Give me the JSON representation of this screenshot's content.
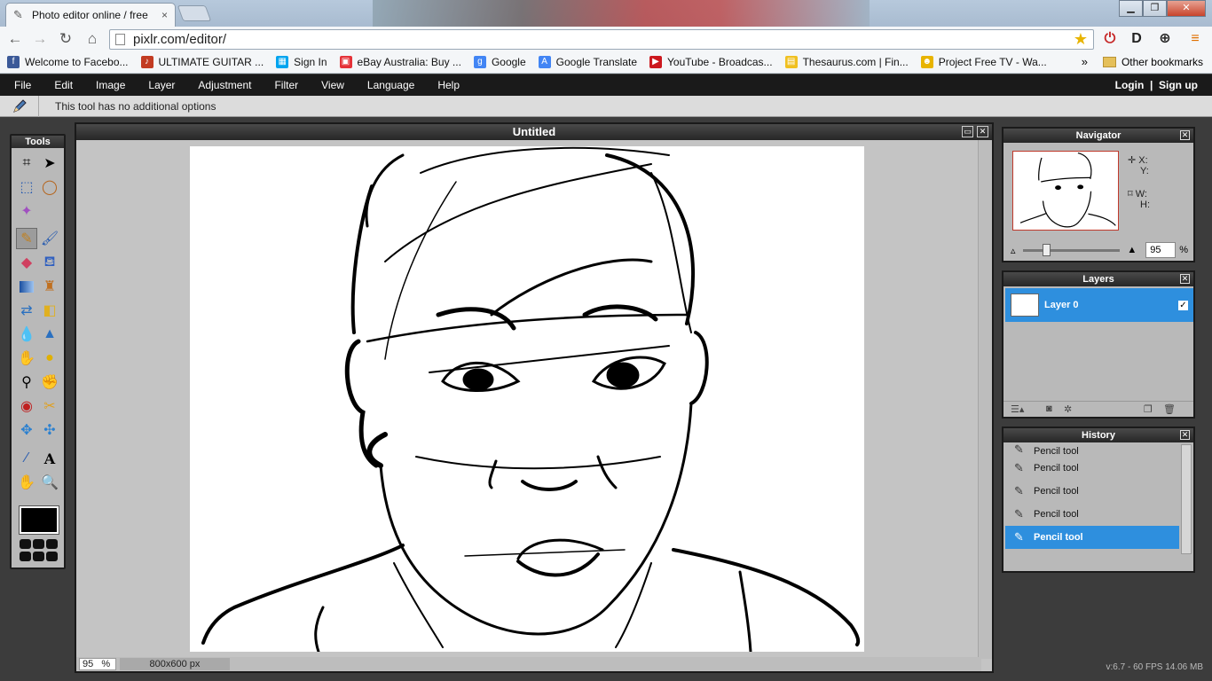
{
  "browser": {
    "tab_title": "Photo editor online / free",
    "tab_close": "×",
    "url": "pixlr.com/editor/",
    "bookmarks": [
      {
        "label": "Welcome to Facebo...",
        "color": "#3b5998",
        "glyph": "f"
      },
      {
        "label": "ULTIMATE GUITAR ...",
        "color": "#c23b22",
        "glyph": "♪"
      },
      {
        "label": "Sign In",
        "color": "#00a4ef",
        "glyph": "▦"
      },
      {
        "label": "eBay Australia: Buy ...",
        "color": "#e53238",
        "glyph": "▣"
      },
      {
        "label": "Google",
        "color": "#4285f4",
        "glyph": "g"
      },
      {
        "label": "Google Translate",
        "color": "#4285f4",
        "glyph": "A"
      },
      {
        "label": "YouTube - Broadcas...",
        "color": "#cc181e",
        "glyph": "▶"
      },
      {
        "label": "Thesaurus.com | Fin...",
        "color": "#f0c020",
        "glyph": "▤"
      },
      {
        "label": "Project Free TV - Wa...",
        "color": "#e8b400",
        "glyph": "☻"
      }
    ],
    "bookmarks_more": "»",
    "other_bookmarks": "Other bookmarks"
  },
  "menu": {
    "items": [
      "File",
      "Edit",
      "Image",
      "Layer",
      "Adjustment",
      "Filter",
      "View",
      "Language",
      "Help"
    ],
    "login": "Login",
    "separator": "|",
    "signup": "Sign up"
  },
  "options": {
    "text": "This tool has no additional options"
  },
  "tools_panel": {
    "title": "Tools"
  },
  "document": {
    "title": "Untitled",
    "zoom": "95",
    "zoom_unit": "%",
    "size": "800x600 px"
  },
  "navigator": {
    "title": "Navigator",
    "x_label": "X:",
    "y_label": "Y:",
    "w_label": "W:",
    "h_label": "H:",
    "zoom": "95",
    "zoom_unit": "%"
  },
  "layers": {
    "title": "Layers",
    "items": [
      {
        "name": "Layer 0",
        "visible": true
      }
    ]
  },
  "history": {
    "title": "History",
    "items": [
      "Pencil tool",
      "Pencil tool",
      "Pencil tool",
      "Pencil tool",
      "Pencil tool"
    ],
    "selected_index": 4
  },
  "status": {
    "version": "v:6.7 - 60 FPS 14.06 MB"
  },
  "colors": {
    "accent": "#2e8fde",
    "primary_color": "#000000"
  }
}
